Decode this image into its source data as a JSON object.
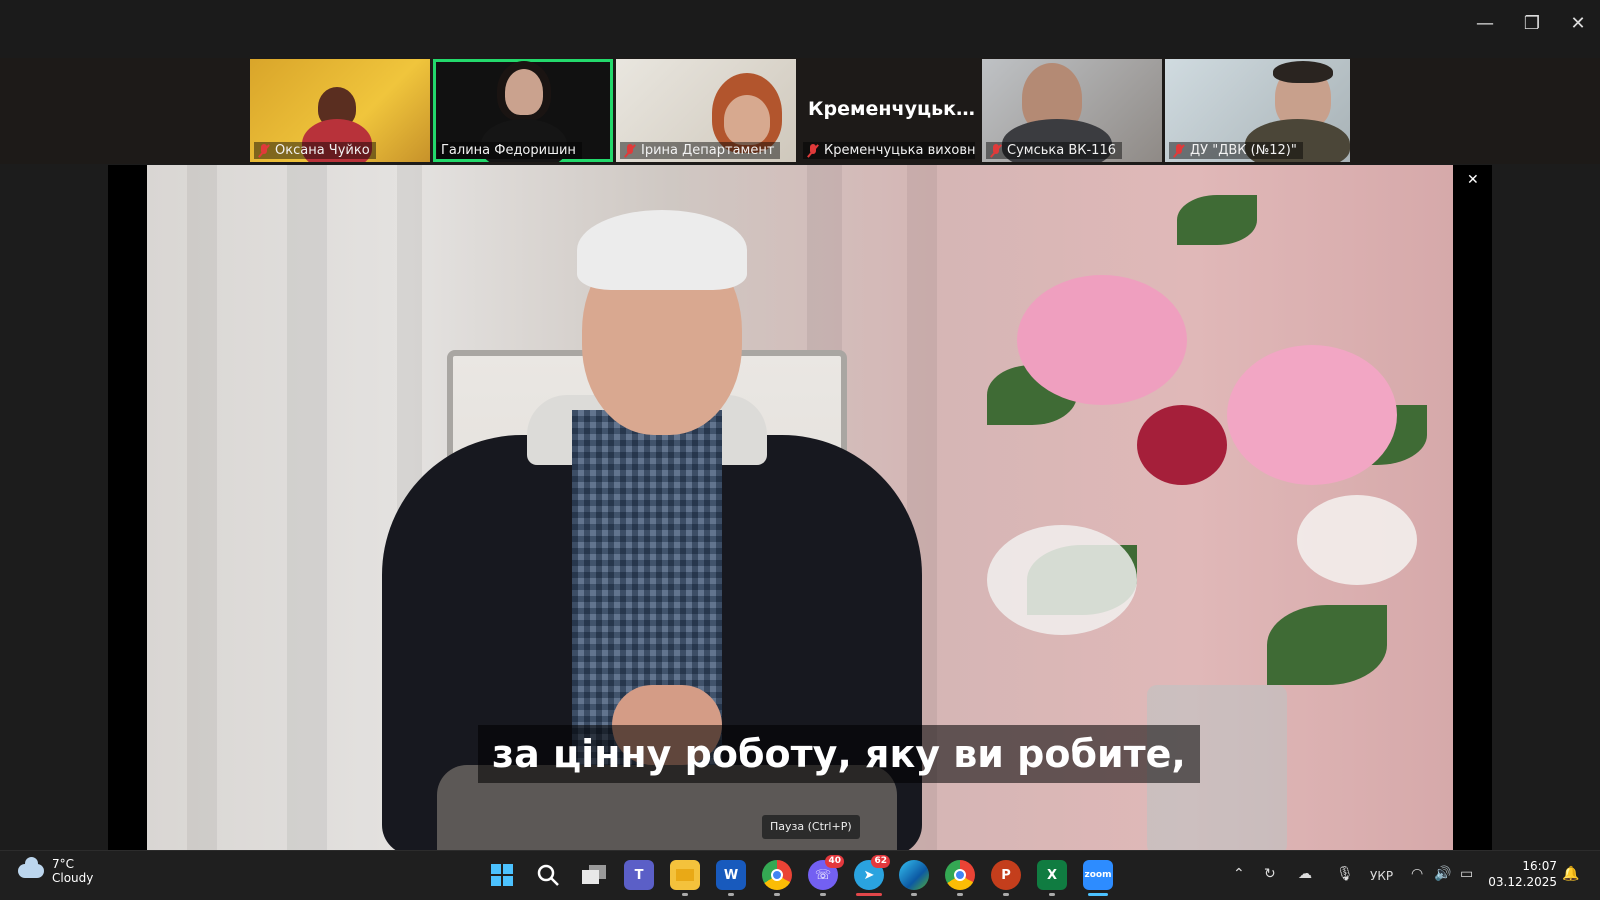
{
  "window": {
    "minimize_glyph": "—",
    "restore_glyph": "❐",
    "close_glyph": "✕"
  },
  "participants": [
    {
      "name": "Оксана Чуйко",
      "muted": true
    },
    {
      "name": "Галина Федоришин",
      "muted": false,
      "active": true
    },
    {
      "name": "Ірина Департамент",
      "muted": true
    },
    {
      "name": "Кременчуцька виховна к...",
      "muted": true,
      "display_title": "Кременчуцька..."
    },
    {
      "name": "Сумська ВК-116",
      "muted": true
    },
    {
      "name": "ДУ \"ДВК (№12)\"",
      "muted": true
    }
  ],
  "video": {
    "subtitle": "за цінну роботу, яку ви робите,",
    "tooltip": "Пауза (Ctrl+P)",
    "close_glyph": "✕"
  },
  "taskbar": {
    "weather": {
      "temp": "7°C",
      "condition": "Cloudy"
    },
    "apps": [
      {
        "icon": "windows-start-icon"
      },
      {
        "icon": "search-icon"
      },
      {
        "icon": "task-view-icon"
      },
      {
        "icon": "teams-icon"
      },
      {
        "icon": "file-explorer-icon"
      },
      {
        "icon": "word-icon",
        "label": "W"
      },
      {
        "icon": "chrome-icon"
      },
      {
        "icon": "viber-icon",
        "badge": "40"
      },
      {
        "icon": "telegram-icon",
        "badge": "62"
      },
      {
        "icon": "edge-icon"
      },
      {
        "icon": "chrome-icon"
      },
      {
        "icon": "powerpoint-icon",
        "label": "P"
      },
      {
        "icon": "excel-icon",
        "label": "X"
      },
      {
        "icon": "zoom-icon",
        "label": "zoom"
      }
    ],
    "tray": {
      "language": "УКР"
    },
    "clock": {
      "time": "16:07",
      "date": "03.12.2025"
    }
  },
  "colors": {
    "active_speaker": "#23d96c",
    "mic_muted": "#e03a3a",
    "badge": "#e4383d"
  }
}
